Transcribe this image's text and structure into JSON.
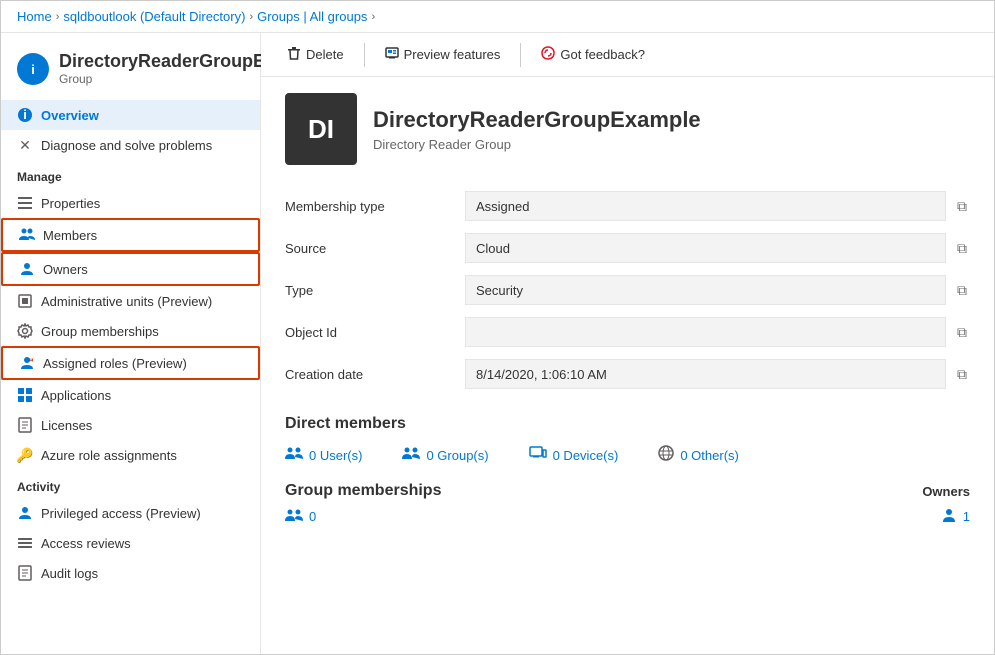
{
  "breadcrumb": {
    "items": [
      "Home",
      "sqldboutlook (Default Directory)",
      "Groups | All groups"
    ]
  },
  "sidebar": {
    "header": {
      "icon_text": "i",
      "title": "DirectoryReaderGroupExample",
      "subtitle": "Group"
    },
    "nav": {
      "top_items": [
        {
          "id": "overview",
          "label": "Overview",
          "icon": "ℹ",
          "active": true
        },
        {
          "id": "diagnose",
          "label": "Diagnose and solve problems",
          "icon": "🔧"
        }
      ],
      "manage_section": "Manage",
      "manage_items": [
        {
          "id": "properties",
          "label": "Properties",
          "icon": "≡"
        },
        {
          "id": "members",
          "label": "Members",
          "icon": "👥",
          "outlined": true
        },
        {
          "id": "owners",
          "label": "Owners",
          "icon": "👤",
          "outlined": true
        },
        {
          "id": "admin-units",
          "label": "Administrative units (Preview)",
          "icon": "🏢"
        },
        {
          "id": "group-memberships",
          "label": "Group memberships",
          "icon": "⚙"
        },
        {
          "id": "assigned-roles",
          "label": "Assigned roles (Preview)",
          "icon": "👤",
          "outlined": true
        },
        {
          "id": "applications",
          "label": "Applications",
          "icon": "▦"
        },
        {
          "id": "licenses",
          "label": "Licenses",
          "icon": "📄"
        },
        {
          "id": "azure-role",
          "label": "Azure role assignments",
          "icon": "🔑"
        }
      ],
      "activity_section": "Activity",
      "activity_items": [
        {
          "id": "privileged-access",
          "label": "Privileged access (Preview)",
          "icon": "👤"
        },
        {
          "id": "access-reviews",
          "label": "Access reviews",
          "icon": "≡"
        },
        {
          "id": "audit-logs",
          "label": "Audit logs",
          "icon": "📋"
        }
      ]
    }
  },
  "toolbar": {
    "delete_label": "Delete",
    "preview_features_label": "Preview features",
    "feedback_label": "Got feedback?"
  },
  "content": {
    "group_avatar_initials": "DI",
    "group_name": "DirectoryReaderGroupExample",
    "group_subtitle": "Directory Reader Group",
    "properties": [
      {
        "label": "Membership type",
        "value": "Assigned"
      },
      {
        "label": "Source",
        "value": "Cloud"
      },
      {
        "label": "Type",
        "value": "Security"
      },
      {
        "label": "Object Id",
        "value": ""
      },
      {
        "label": "Creation date",
        "value": "8/14/2020, 1:06:10 AM"
      }
    ],
    "direct_members_title": "Direct members",
    "members_stats": [
      {
        "icon": "👥",
        "label": "0 User(s)"
      },
      {
        "icon": "👥",
        "label": "0 Group(s)"
      },
      {
        "icon": "🖥",
        "label": "0 Device(s)"
      },
      {
        "icon": "🌐",
        "label": "0 Other(s)"
      }
    ],
    "group_memberships_title": "Group memberships",
    "owners_label": "Owners",
    "memberships_count": "0",
    "owners_count": "1"
  }
}
